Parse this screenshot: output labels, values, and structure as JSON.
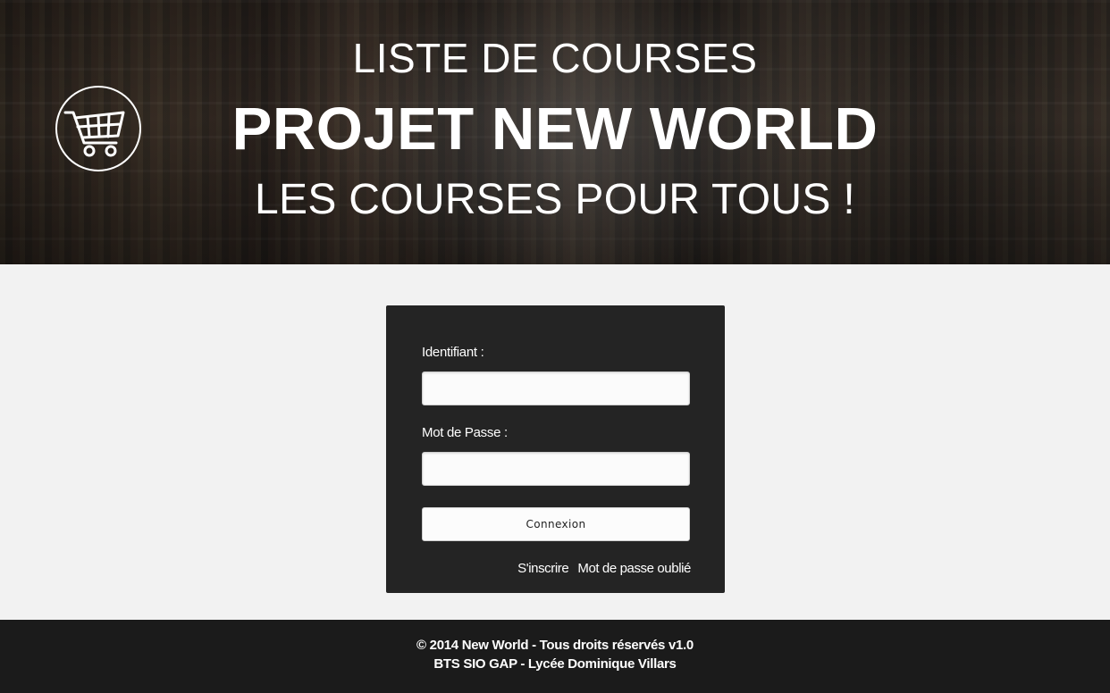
{
  "header": {
    "line1": "LISTE DE COURSES",
    "line2": "PROJET NEW WORLD",
    "line3": "LES COURSES POUR TOUS !",
    "logo_icon": "shopping-cart-icon"
  },
  "login": {
    "username_label": "Identifiant :",
    "username_value": "",
    "password_label": "Mot de Passe :",
    "password_value": "",
    "submit_label": "Connexion",
    "register_link": "S'inscrire",
    "forgot_link": "Mot de passe oublié"
  },
  "footer": {
    "line1": "© 2014 New World - Tous droits réservés v1.0",
    "line2": "BTS SIO GAP - Lycée Dominique Villars"
  },
  "colors": {
    "panel_bg": "#242424",
    "footer_bg": "#1b1b1b",
    "page_bg": "#f2f2f2",
    "text_light": "#ffffff"
  }
}
